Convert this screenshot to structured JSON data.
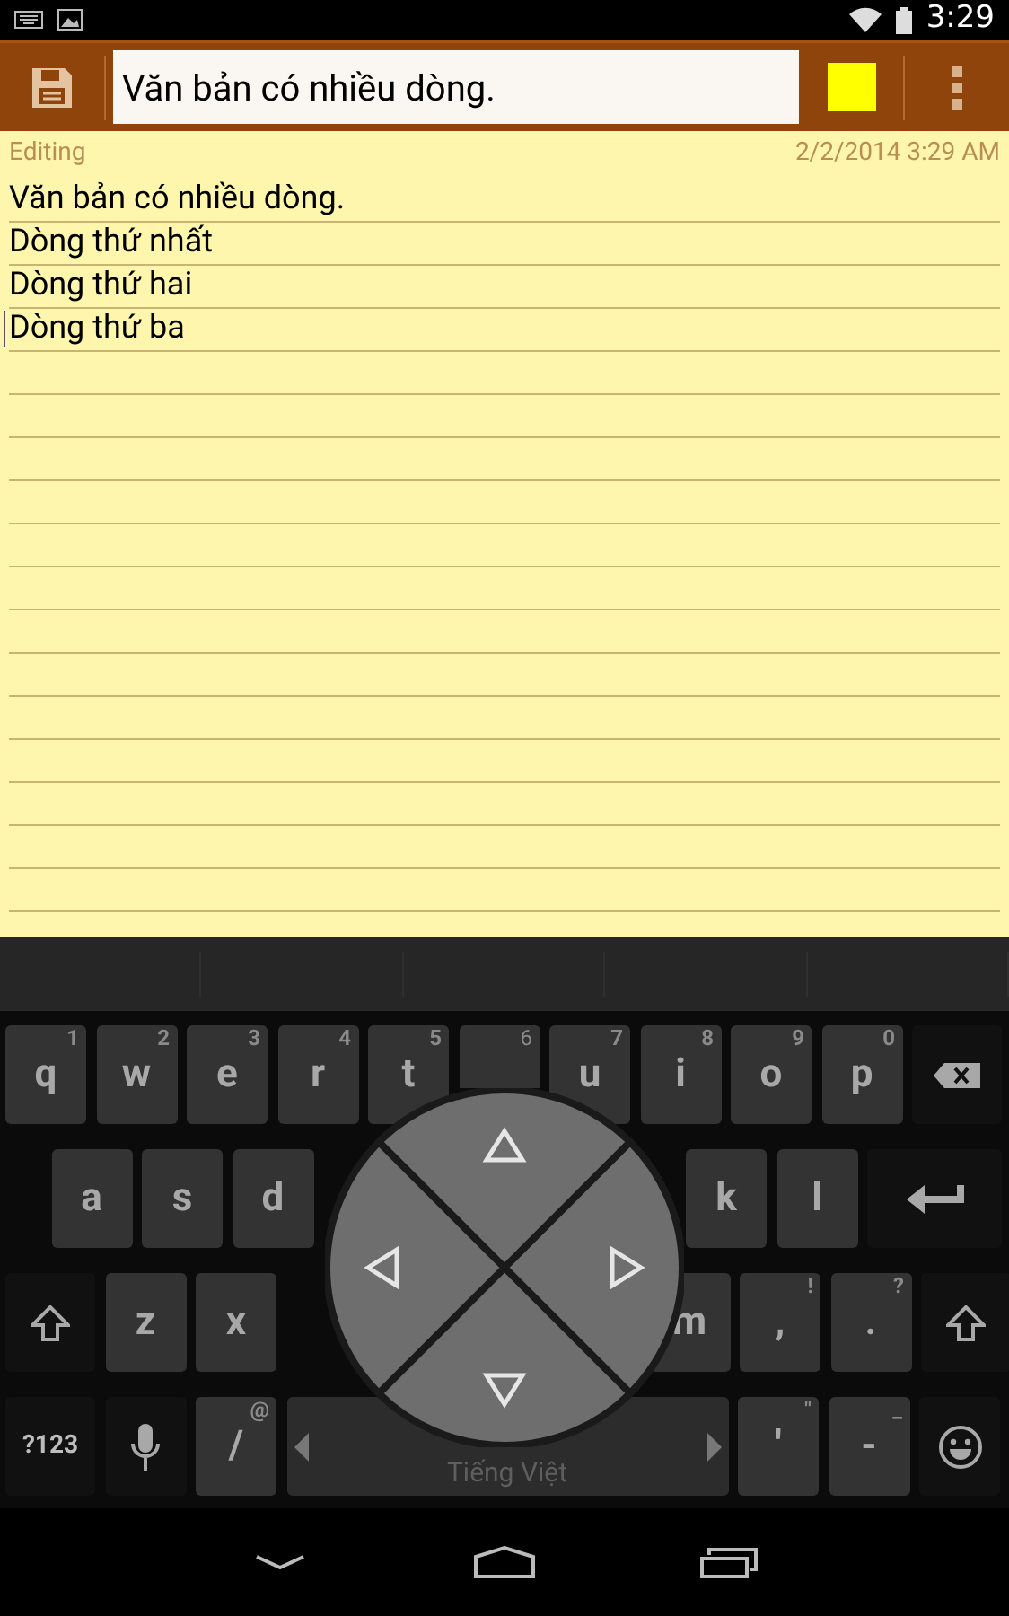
{
  "status_bar": {
    "time": "3:29"
  },
  "toolbar": {
    "title_value": "Văn bản có nhiều dòng."
  },
  "note": {
    "status": "Editing",
    "timestamp": "2/2/2014 3:29 AM",
    "lines": [
      {
        "text": "Văn bản có nhiều dòng.",
        "cursor": false
      },
      {
        "text": "Dòng thứ nhất",
        "cursor": false
      },
      {
        "text": "Dòng thứ hai",
        "cursor": false
      },
      {
        "text": "Dòng thứ ba",
        "cursor": true
      }
    ]
  },
  "keyboard": {
    "rows": [
      {
        "keys": [
          {
            "kind": "key",
            "label": "q",
            "hint": "1"
          },
          {
            "kind": "key",
            "label": "w",
            "hint": "2"
          },
          {
            "kind": "key",
            "label": "e",
            "hint": "3"
          },
          {
            "kind": "key",
            "label": "r",
            "hint": "4"
          },
          {
            "kind": "key",
            "label": "t",
            "hint": "5"
          },
          {
            "kind": "partial",
            "hint": "6"
          },
          {
            "kind": "key",
            "label": "u",
            "hint": "7"
          },
          {
            "kind": "key",
            "label": "i",
            "hint": "8"
          },
          {
            "kind": "key",
            "label": "o",
            "hint": "9"
          },
          {
            "kind": "key",
            "label": "p",
            "hint": "0"
          },
          {
            "kind": "backspace"
          }
        ]
      },
      {
        "keys": [
          {
            "kind": "spacer"
          },
          {
            "kind": "key",
            "label": "a"
          },
          {
            "kind": "key",
            "label": "s"
          },
          {
            "kind": "key",
            "label": "d"
          },
          {
            "kind": "covered"
          },
          {
            "kind": "covered"
          },
          {
            "kind": "covered"
          },
          {
            "kind": "covered"
          },
          {
            "kind": "key",
            "label": "k"
          },
          {
            "kind": "key",
            "label": "l"
          },
          {
            "kind": "enter"
          }
        ]
      },
      {
        "keys": [
          {
            "kind": "shift"
          },
          {
            "kind": "key",
            "label": "z"
          },
          {
            "kind": "key",
            "label": "x"
          },
          {
            "kind": "covered"
          },
          {
            "kind": "covered"
          },
          {
            "kind": "covered"
          },
          {
            "kind": "covered"
          },
          {
            "kind": "key",
            "label": "m"
          },
          {
            "kind": "key",
            "label": ",",
            "hint": "!"
          },
          {
            "kind": "key",
            "label": ".",
            "hint": "?"
          },
          {
            "kind": "shift"
          }
        ]
      },
      {
        "keys": [
          {
            "kind": "mode",
            "label": "?123"
          },
          {
            "kind": "mic"
          },
          {
            "kind": "key",
            "label": "/",
            "hint": "@"
          },
          {
            "kind": "space",
            "label": "Tiếng Việt"
          },
          {
            "kind": "key",
            "label": "'",
            "hint": "\""
          },
          {
            "kind": "key",
            "label": "-",
            "hint": "_"
          },
          {
            "kind": "emoji"
          }
        ]
      }
    ]
  }
}
